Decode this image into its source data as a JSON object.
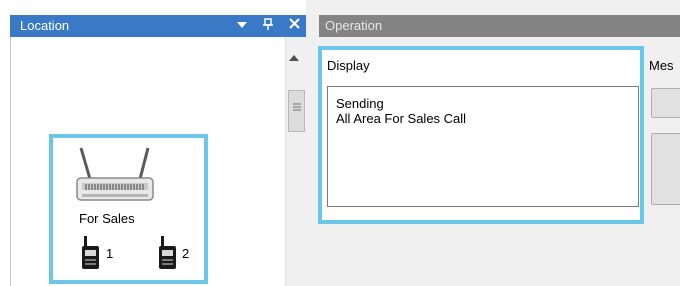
{
  "location_pane": {
    "title": "Location",
    "controls": {
      "dropdown_icon": "dropdown-triangle-icon",
      "pin_icon": "pin-icon",
      "close_icon": "close-icon"
    },
    "device": {
      "icon": "router-antenna-icon",
      "label": "For Sales",
      "radios": [
        {
          "icon": "handheld-radio-icon",
          "number": "1"
        },
        {
          "icon": "handheld-radio-icon",
          "number": "2"
        }
      ]
    }
  },
  "operation_pane": {
    "title": "Operation",
    "display": {
      "label": "Display",
      "lines": [
        "Sending",
        "All Area For Sales Call"
      ]
    },
    "message": {
      "label": "Mes"
    }
  },
  "colors": {
    "active_header": "#3a79c5",
    "inactive_header": "#848484",
    "highlight": "#6cc6ea"
  }
}
